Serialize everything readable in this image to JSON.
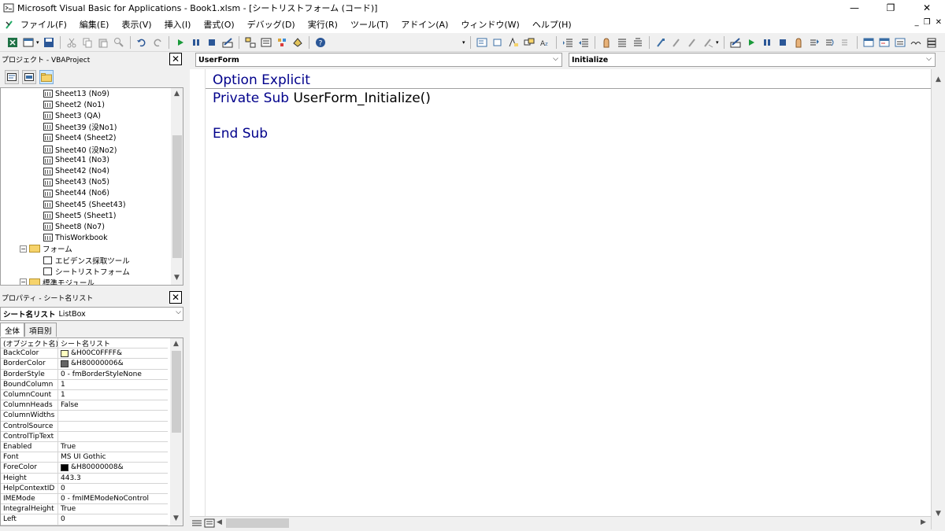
{
  "window": {
    "title": "Microsoft Visual Basic for Applications - Book1.xlsm - [シートリストフォーム (コード)]",
    "minimize": "—",
    "restore": "❐",
    "close": "✕"
  },
  "menu": {
    "items": [
      "ファイル(F)",
      "編集(E)",
      "表示(V)",
      "挿入(I)",
      "書式(O)",
      "デバッグ(D)",
      "実行(R)",
      "ツール(T)",
      "アドイン(A)",
      "ウィンドウ(W)",
      "ヘルプ(H)"
    ],
    "mdi_min": "_",
    "mdi_restore": "❐",
    "mdi_close": "✕"
  },
  "project_pane": {
    "title": "プロジェクト - VBAProject",
    "close": "✕",
    "tree": [
      {
        "label": "Sheet13 (No9)",
        "icon": "sheet-icon"
      },
      {
        "label": "Sheet2 (No1)",
        "icon": "sheet-icon"
      },
      {
        "label": "Sheet3 (QA)",
        "icon": "sheet-icon"
      },
      {
        "label": "Sheet39 (没No1)",
        "icon": "sheet-icon"
      },
      {
        "label": "Sheet4 (Sheet2)",
        "icon": "sheet-icon"
      },
      {
        "label": "Sheet40 (没No2)",
        "icon": "sheet-icon"
      },
      {
        "label": "Sheet41 (No3)",
        "icon": "sheet-icon"
      },
      {
        "label": "Sheet42 (No4)",
        "icon": "sheet-icon"
      },
      {
        "label": "Sheet43 (No5)",
        "icon": "sheet-icon"
      },
      {
        "label": "Sheet44 (No6)",
        "icon": "sheet-icon"
      },
      {
        "label": "Sheet45 (Sheet43)",
        "icon": "sheet-icon"
      },
      {
        "label": "Sheet5 (Sheet1)",
        "icon": "sheet-icon"
      },
      {
        "label": "Sheet8 (No7)",
        "icon": "sheet-icon"
      },
      {
        "label": "ThisWorkbook",
        "icon": "workbook-icon"
      },
      {
        "label": "フォーム",
        "icon": "folder-icon"
      },
      {
        "label": "エビデンス採取ツール",
        "icon": "form-icon"
      },
      {
        "label": "シートリストフォーム",
        "icon": "form-icon"
      },
      {
        "label": "標準モジュール",
        "icon": "folder-icon"
      }
    ],
    "toggle_minus": "−"
  },
  "properties_pane": {
    "title": "プロパティ - シート名リスト",
    "close": "✕",
    "object_name": "シート名リスト",
    "object_type": "ListBox",
    "tabs": [
      "全体",
      "項目別"
    ],
    "rows": [
      {
        "name": "(オブジェクト名)",
        "value": "シート名リスト",
        "swatch": ""
      },
      {
        "name": "BackColor",
        "value": "&H00C0FFFF&",
        "swatch": "#ffffc0"
      },
      {
        "name": "BorderColor",
        "value": "&H80000006&",
        "swatch": "#646464"
      },
      {
        "name": "BorderStyle",
        "value": "0 - fmBorderStyleNone",
        "swatch": ""
      },
      {
        "name": "BoundColumn",
        "value": "1",
        "swatch": ""
      },
      {
        "name": "ColumnCount",
        "value": "1",
        "swatch": ""
      },
      {
        "name": "ColumnHeads",
        "value": "False",
        "swatch": ""
      },
      {
        "name": "ColumnWidths",
        "value": "",
        "swatch": ""
      },
      {
        "name": "ControlSource",
        "value": "",
        "swatch": ""
      },
      {
        "name": "ControlTipText",
        "value": "",
        "swatch": ""
      },
      {
        "name": "Enabled",
        "value": "True",
        "swatch": ""
      },
      {
        "name": "Font",
        "value": "MS UI Gothic",
        "swatch": ""
      },
      {
        "name": "ForeColor",
        "value": "&H80000008&",
        "swatch": "#000000"
      },
      {
        "name": "Height",
        "value": "443.3",
        "swatch": ""
      },
      {
        "name": "HelpContextID",
        "value": "0",
        "swatch": ""
      },
      {
        "name": "IMEMode",
        "value": "0 - fmIMEModeNoControl",
        "swatch": ""
      },
      {
        "name": "IntegralHeight",
        "value": "True",
        "swatch": ""
      },
      {
        "name": "Left",
        "value": "0",
        "swatch": ""
      }
    ]
  },
  "code_window": {
    "object_select": "UserForm",
    "proc_select": "Initialize",
    "lines": [
      [
        {
          "t": "Option Explicit",
          "kw": true
        }
      ],
      [
        {
          "t": "Private Sub ",
          "kw": true
        },
        {
          "t": "UserForm_Initialize()",
          "kw": false
        }
      ],
      [
        {
          "t": "",
          "kw": false
        }
      ],
      [
        {
          "t": "End Sub",
          "kw": true
        }
      ]
    ]
  },
  "colors": {
    "keyword": "#00008b"
  }
}
